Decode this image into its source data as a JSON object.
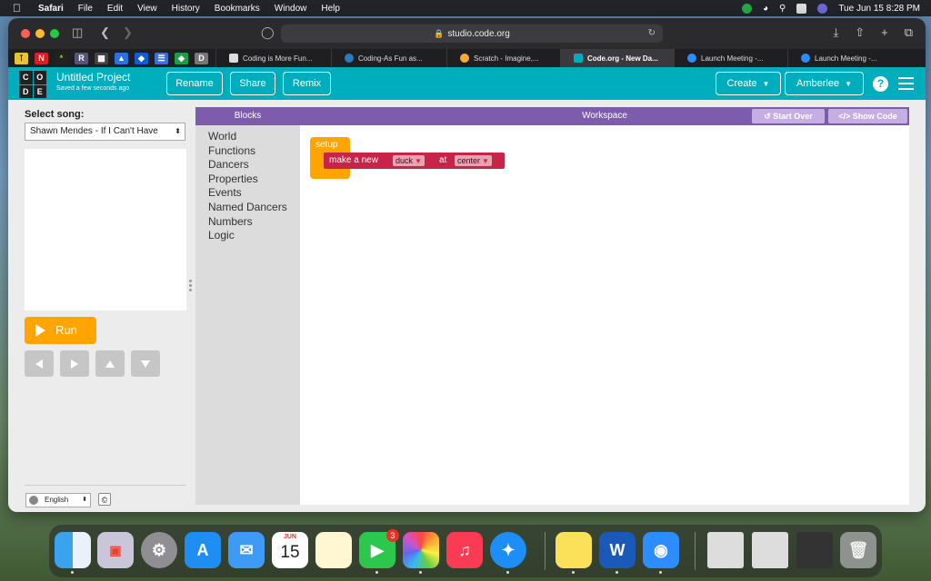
{
  "menubar": {
    "app": "Safari",
    "items": [
      "File",
      "Edit",
      "View",
      "History",
      "Bookmarks",
      "Window",
      "Help"
    ],
    "datetime": "Tue Jun 15  8:28 PM"
  },
  "browser": {
    "url": "studio.code.org",
    "tabs": [
      {
        "label": "Coding is More Fun..."
      },
      {
        "label": "Coding-As Fun as..."
      },
      {
        "label": "Scratch - Imagine,..."
      },
      {
        "label": "Code.org - New Da..."
      },
      {
        "label": "Launch Meeting -..."
      },
      {
        "label": "Launch Meeting -..."
      }
    ]
  },
  "header": {
    "logo_letters": [
      "C",
      "O",
      "D",
      "E"
    ],
    "project_title": "Untitled Project",
    "save_status": "Saved a few seconds ago",
    "rename_label": "Rename",
    "share_label": "Share",
    "remix_label": "Remix",
    "create_label": "Create",
    "user_label": "Amberlee",
    "help_label": "?"
  },
  "left": {
    "select_song_label": "Select song:",
    "song": "Shawn Mendes - If I Can't Have",
    "run_label": "Run",
    "language": "English",
    "copyright": "©"
  },
  "toolbox": {
    "title": "Blocks",
    "categories": [
      "World",
      "Functions",
      "Dancers",
      "Properties",
      "Events",
      "Named Dancers",
      "Numbers",
      "Logic"
    ]
  },
  "workspace": {
    "title": "Workspace",
    "start_over_label": "Start Over",
    "show_code_label": "Show Code",
    "setup_label": "setup",
    "block_text": "make a new",
    "dancer_value": "duck",
    "at_text": "at",
    "position_value": "center"
  },
  "dock": {
    "facetime_badge": "3",
    "calendar_month": "JUN",
    "calendar_day": "15"
  },
  "colors": {
    "codeorg_teal": "#00adbc",
    "blocks_purple": "#7c5cab",
    "run_orange": "#ffa400",
    "block_red": "#c8244a"
  }
}
